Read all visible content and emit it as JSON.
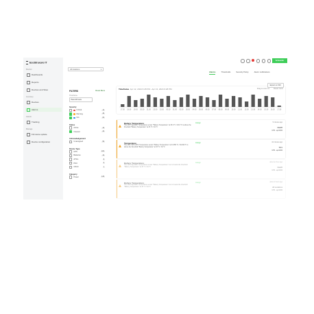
{
  "brand": {
    "name": "EcoStruxure IT"
  },
  "sidebar": {
    "sections": [
      {
        "label": "Monitor",
        "items": [
          {
            "label": "Dashboards",
            "active": false
          },
          {
            "label": "Reports",
            "active": false
          },
          {
            "label": "Devices and Sites",
            "active": false
          }
        ]
      },
      {
        "label": "Inventory",
        "items": [
          {
            "label": "Devices",
            "active": false
          },
          {
            "label": "Alarms",
            "active": true
          }
        ]
      },
      {
        "label": "Assets",
        "items": [
          {
            "label": "Tracking",
            "active": false
          }
        ]
      },
      {
        "label": "Manage",
        "items": [
          {
            "label": "Firmware update",
            "active": false
          },
          {
            "label": "Device configuration",
            "active": false
          }
        ]
      }
    ]
  },
  "topbar": {
    "logo_text": "Schneider"
  },
  "location_select": {
    "value": "All locations"
  },
  "tabs": [
    {
      "label": "Alarms",
      "active": true
    },
    {
      "label": "Thresholds",
      "active": false
    },
    {
      "label": "Security Policy",
      "active": false
    },
    {
      "label": "Alarm notifications",
      "active": false
    }
  ],
  "filters": {
    "title": "FILTERS",
    "reset": "Reset filters",
    "timeframe_label": "Timeframe",
    "timeframe_value": "Past 24 hours",
    "groups": [
      {
        "heading": "Severity",
        "options": [
          {
            "label": "Critical",
            "count": "14",
            "checked": false,
            "dot": "#e53935"
          },
          {
            "label": "Warning",
            "count": "36",
            "checked": true,
            "dot": "#f5a623"
          },
          {
            "label": "Info",
            "count": "06",
            "checked": true,
            "dot": "#1e88e5"
          }
        ]
      },
      {
        "heading": "Status",
        "options": [
          {
            "label": "Active",
            "count": "12",
            "checked": false
          },
          {
            "label": "Cleared",
            "count": "44",
            "checked": true
          }
        ]
      },
      {
        "heading": "Acknowledgement",
        "options": [
          {
            "label": "Unassigned",
            "count": "56",
            "checked": false
          }
        ]
      },
      {
        "heading": "Device Type",
        "options": [
          {
            "label": "UPS",
            "count": "104",
            "checked": false
          },
          {
            "label": "Batteries",
            "count": "14",
            "checked": false
          },
          {
            "label": "ATS/s",
            "count": "8",
            "checked": false
          },
          {
            "label": "PDU",
            "count": "6",
            "checked": false
          },
          {
            "label": "CRAC",
            "count": "1",
            "checked": false
          }
        ]
      },
      {
        "heading": "Category",
        "options": [
          {
            "label": "Power",
            "count": "146",
            "checked": false
          }
        ]
      }
    ]
  },
  "timeframe_panel": {
    "title": "Timeframe",
    "range": "Apr 12, 2024 6:28 PM  -  Apr 13, 2024 6:28 PM",
    "links": [
      "Drag to zoom in",
      "Reset zoom"
    ],
    "export_label": "Export to CSV"
  },
  "chart_data": {
    "type": "bar",
    "categories": [
      "17:30",
      "18:30",
      "19:30",
      "20:30",
      "21:30",
      "22:30",
      "23:30",
      "00:30",
      "01:30",
      "02:30",
      "03:30",
      "04:30",
      "05:30",
      "06:30",
      "07:30",
      "08:30",
      "09:30",
      "10:30",
      "11:30",
      "12:30",
      "13:30",
      "14:30",
      "15:30",
      "16:30",
      "17:30"
    ],
    "values": [
      2,
      8,
      5,
      6,
      9,
      7,
      6,
      8,
      5,
      7,
      9,
      6,
      8,
      7,
      5,
      9,
      6,
      8,
      7,
      4,
      9,
      6,
      8,
      7,
      1
    ],
    "ylim": [
      0,
      10
    ],
    "grid": false,
    "bar_color": "#555555"
  },
  "alerts": [
    {
      "title": "Battery Temperature",
      "desc": "The UPS \"apc1000\" Temperature sensor \"Battery Temperature\" at 33.9 °C / 93.0 °F is above the threshold \"Battery Temperature\" at 33 °C / 91 °F",
      "assign": "Assign",
      "time": "5 minutes ago",
      "device": "Rack5",
      "location": "UPS - apc1000",
      "faded": false
    },
    {
      "title": "Temperature",
      "desc": "The UPS \"APC UPS\" Temperature sensor \"Battery Temperature\" at 34.055 °C / 93.299 °F is above the threshold \"Battery Temperature\" at 33 °C / 91 °F",
      "assign": "Assign",
      "time": "44 minutes ago",
      "device": "NC1",
      "location": "UPS - apc1000",
      "faded": false
    },
    {
      "title": "Battery Temperature",
      "desc": "The UPS \"apc1000\" Temperature sensor \"Battery Temperature\" is at or below the threshold \"Battery Temperature\" at 33 °C / 91 °F",
      "assign": "Assign",
      "time": "about an hour ago",
      "device": "Rack5",
      "location": "UPS - apc1000",
      "faded": true
    },
    {
      "title": "Battery Temperature",
      "desc": "The UPS \"apc1000\" Temperature sensor \"Battery Temperature\" is at or below the threshold \"Battery Temperature\" at 33 °C / 91 °F",
      "assign": "Assign",
      "time": "about 2 hours ago",
      "device": "All Locations",
      "location": "UPS - apc1000",
      "faded": true
    }
  ]
}
